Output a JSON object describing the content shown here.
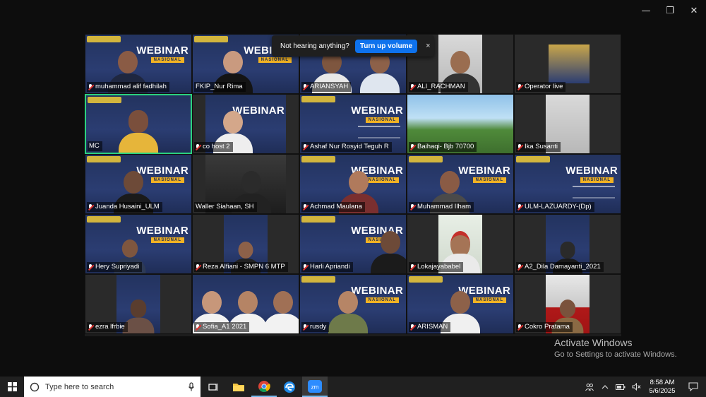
{
  "window": {
    "minimize_glyph": "—",
    "restore_glyph": "❐",
    "close_glyph": "✕"
  },
  "banner": {
    "message": "Not hearing anything?",
    "button_label": "Turn up volume",
    "close_glyph": "×"
  },
  "webinar_slide": {
    "title": "WEBINAR",
    "subtitle": "NASIONAL"
  },
  "participants": [
    {
      "name": "muhammad alif fadhilah",
      "muted": true
    },
    {
      "name": "FKIP_Nur Rima",
      "muted": false
    },
    {
      "name": "ARIANSYAH",
      "muted": true
    },
    {
      "name": "ALI_RACHMAN",
      "muted": true
    },
    {
      "name": "Operator live",
      "muted": true
    },
    {
      "name": "MC",
      "muted": false,
      "speaking": true
    },
    {
      "name": "co host 2",
      "muted": false
    },
    {
      "name": "Ashaf Nur Rosyid Teguh R",
      "muted": true
    },
    {
      "name": "Baihaqi- Bjb 70700",
      "muted": true
    },
    {
      "name": "Ika Susanti",
      "muted": true
    },
    {
      "name": "Juanda Husaini_ULM",
      "muted": true
    },
    {
      "name": "Waller Siahaan, SH",
      "muted": false
    },
    {
      "name": "Achmad Maulana",
      "muted": true
    },
    {
      "name": "Muhammad Ilham",
      "muted": true
    },
    {
      "name": "ULM-LAZUARDY-(Dp)",
      "muted": true
    },
    {
      "name": "Hery Supriyadi",
      "muted": true
    },
    {
      "name": "Reza Alfiani - SMPN 6 MTP",
      "muted": true
    },
    {
      "name": "Harli Apriandi",
      "muted": true
    },
    {
      "name": "Lokajayababel",
      "muted": true
    },
    {
      "name": "A2_Dila Damayanti_2021",
      "muted": true
    },
    {
      "name": "ezra lfrbie",
      "muted": true
    },
    {
      "name": "Sofia_A1 2021",
      "muted": true
    },
    {
      "name": "rusdy",
      "muted": true
    },
    {
      "name": "ARISMAN",
      "muted": true
    },
    {
      "name": "Cokro Pratama",
      "muted": true
    }
  ],
  "watermark": {
    "title": "Activate Windows",
    "subtitle": "Go to Settings to activate Windows."
  },
  "taskbar": {
    "search_placeholder": "Type here to search",
    "time": "8:58 AM",
    "date": "5/6/2025",
    "zoom_label": "zm"
  },
  "colors": {
    "zoom_blue": "#0e72ed",
    "active_speaker": "#2bd17e",
    "muted_red": "#e0322f"
  }
}
